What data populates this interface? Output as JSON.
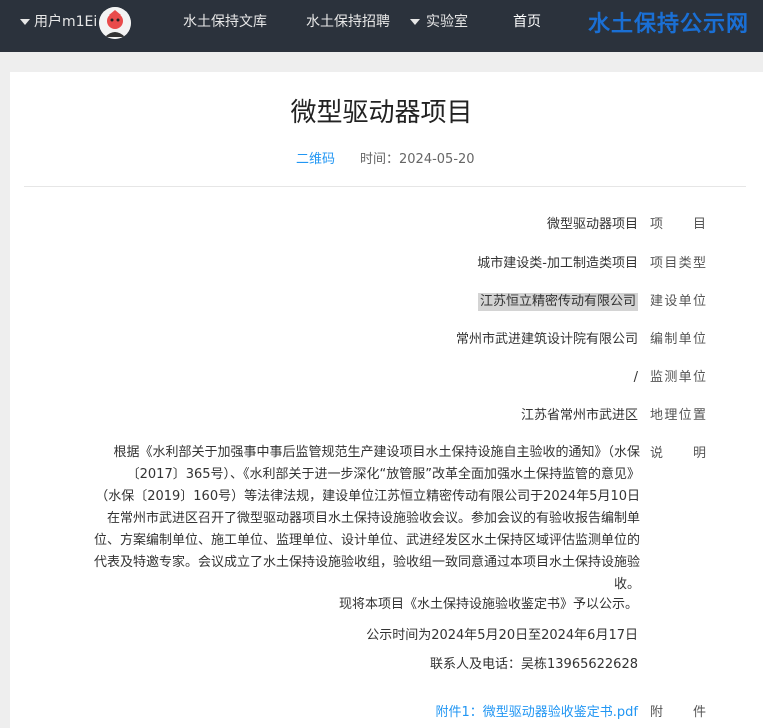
{
  "navbar": {
    "brand": "水土保持公示网",
    "home": "首页",
    "lab": "实验室",
    "jobs": "水土保持招聘",
    "library": "水土保持文库",
    "user": "用户m1Ei"
  },
  "article": {
    "title": "微型驱动器项目",
    "time_label": "时间：2024-05-20",
    "qr_label": "二维码"
  },
  "fields": [
    {
      "label": "项目",
      "value": "微型驱动器项目"
    },
    {
      "label": "项目类型",
      "value": "城市建设类-加工制造类项目"
    },
    {
      "label": "建设单位",
      "value": "江苏恒立精密传动有限公司"
    },
    {
      "label": "编制单位",
      "value": "常州市武进建筑设计院有限公司"
    },
    {
      "label": "监测单位",
      "value": "/"
    },
    {
      "label": "地理位置",
      "value": "江苏省常州市武进区"
    }
  ],
  "description": {
    "label": "说明",
    "lines": [
      "根据《水利部关于加强事中事后监管规范生产建设项目水土保持设施自主验收的通知》（水保",
      "〔2017〕365号）、《水利部关于进一步深化“放管服”改革全面加强水土保持监管的意见》",
      "（水保〔2019〕160号）等法律法规，建设单位江苏恒立精密传动有限公司于2024年5月10日",
      "在常州市武进区召开了微型驱动器项目水土保持设施验收会议。参加会议的有验收报告编制单",
      "位、方案编制单位、施工单位、监理单位、设计单位、武进经发区水土保持区域评估监测单位的",
      "代表及特邀专家。会议成立了水土保持设施验收组，验收组一致同意通过本项目水土保持设施验",
      "收。"
    ],
    "p1": "现将本项目《水土保持设施验收鉴定书》予以公示。",
    "p2": "公示时间为2024年5月20日至2024年6月17日",
    "p3": "联系人及电话：吴栋13965622628"
  },
  "attachment": {
    "label": "附件",
    "link": "附件1：微型驱动器验收鉴定书.pdf"
  },
  "colors": {
    "navbar_bg": "#2b323c",
    "brand": "#1a6fd4",
    "link": "#2196f3",
    "highlight": "#d4d4d4"
  }
}
